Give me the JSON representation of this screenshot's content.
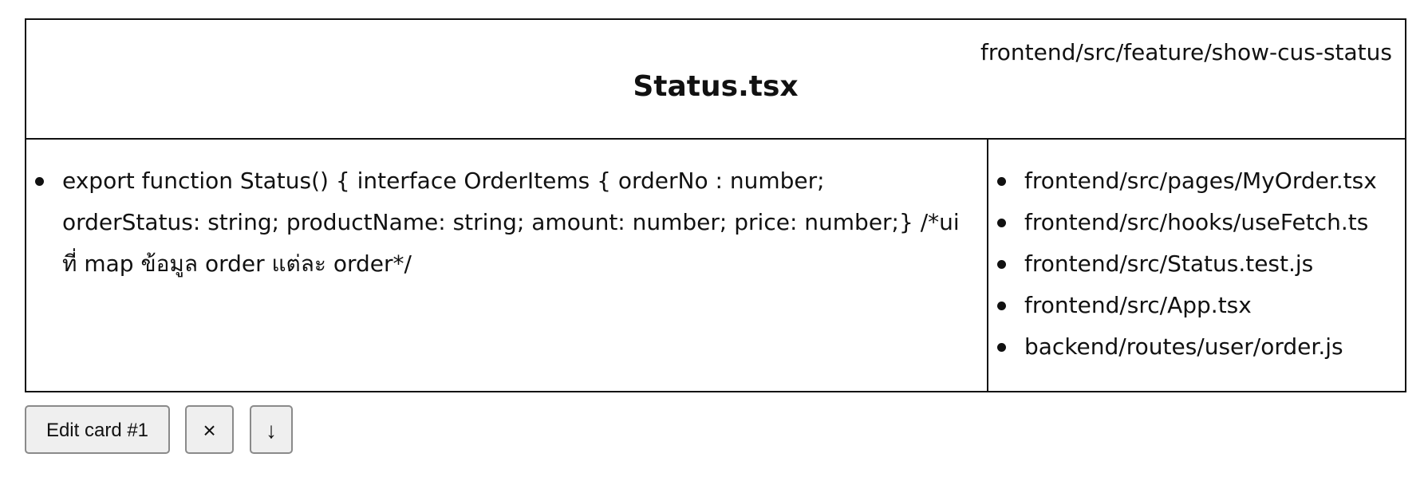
{
  "card": {
    "path": "frontend/src/feature/show-cus-status",
    "title": "Status.tsx",
    "main_items": [
      "export function Status() { interface OrderItems { orderNo : number; orderStatus: string; productName: string; amount: number; price: number;} /*ui ที่ map ข้อมูล order แต่ละ order*/"
    ],
    "related_files": [
      "frontend/src/pages/MyOrder.tsx",
      "frontend/src/hooks/useFetch.ts",
      "frontend/src/Status.test.js",
      "frontend/src/App.tsx",
      "backend/routes/user/order.js"
    ]
  },
  "actions": {
    "edit_label": "Edit card #1",
    "close_icon": "×",
    "down_icon": "↓"
  },
  "icons": {
    "close": "close-icon",
    "down": "arrow-down-icon"
  }
}
